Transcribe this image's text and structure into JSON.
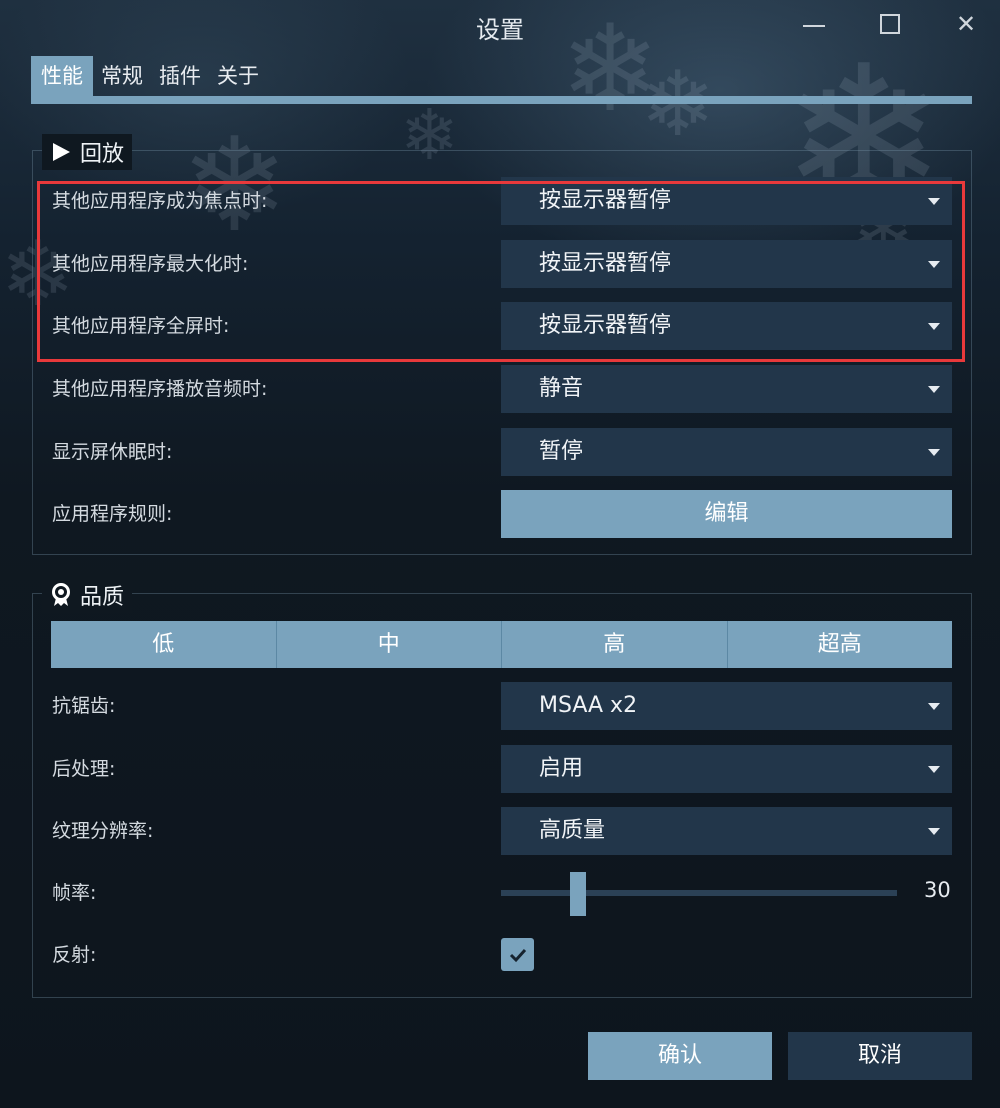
{
  "window": {
    "title": "设置"
  },
  "tabs": [
    {
      "label": "性能",
      "active": true
    },
    {
      "label": "常规",
      "active": false
    },
    {
      "label": "插件",
      "active": false
    },
    {
      "label": "关于",
      "active": false
    }
  ],
  "playback": {
    "title": "回放",
    "icon": "play-icon",
    "rows": [
      {
        "label": "其他应用程序成为焦点时:",
        "value": "按显示器暂停"
      },
      {
        "label": "其他应用程序最大化时:",
        "value": "按显示器暂停"
      },
      {
        "label": "其他应用程序全屏时:",
        "value": "按显示器暂停"
      },
      {
        "label": "其他应用程序播放音频时:",
        "value": "静音"
      },
      {
        "label": "显示屏休眠时:",
        "value": "暂停"
      }
    ],
    "app_rules": {
      "label": "应用程序规则:",
      "button": "编辑"
    }
  },
  "quality": {
    "title": "品质",
    "icon": "award-icon",
    "presets": [
      "低",
      "中",
      "高",
      "超高"
    ],
    "antialias": {
      "label": "抗锯齿:",
      "value": "MSAA x2"
    },
    "postprocess": {
      "label": "后处理:",
      "value": "启用"
    },
    "texture": {
      "label": "纹理分辨率:",
      "value": "高质量"
    },
    "framerate": {
      "label": "帧率:",
      "value": "30"
    },
    "reflection": {
      "label": "反射:",
      "checked": true
    }
  },
  "footer": {
    "ok": "确认",
    "cancel": "取消"
  },
  "colors": {
    "accent": "#7aa3bd",
    "select_bg": "#22364a",
    "highlight": "#e8393b"
  }
}
